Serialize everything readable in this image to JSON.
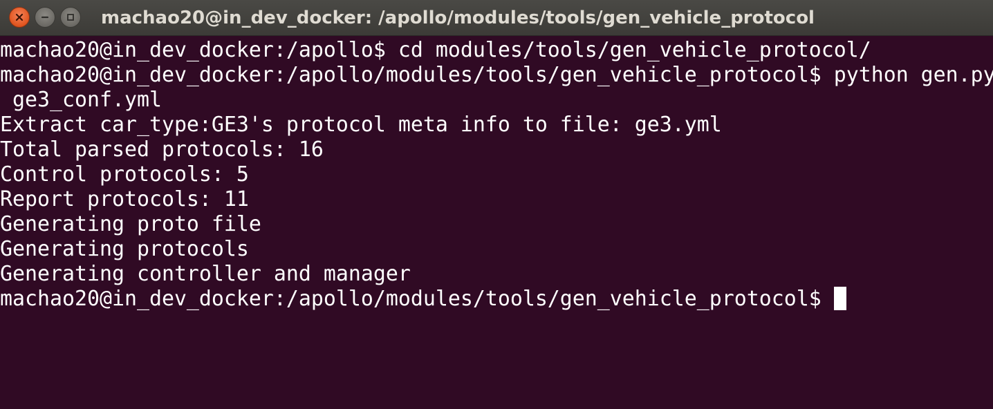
{
  "window": {
    "title": "machao20@in_dev_docker: /apollo/modules/tools/gen_vehicle_protocol"
  },
  "terminal": {
    "lines": [
      "machao20@in_dev_docker:/apollo$ cd modules/tools/gen_vehicle_protocol/",
      "machao20@in_dev_docker:/apollo/modules/tools/gen_vehicle_protocol$ python gen.py",
      " ge3_conf.yml",
      "Extract car_type:GE3's protocol meta info to file: ge3.yml",
      "Total parsed protocols: 16",
      "Control protocols: 5",
      "Report protocols: 11",
      "Generating proto file",
      "Generating protocols",
      "Generating controller and manager"
    ],
    "prompt": "machao20@in_dev_docker:/apollo/modules/tools/gen_vehicle_protocol$"
  }
}
